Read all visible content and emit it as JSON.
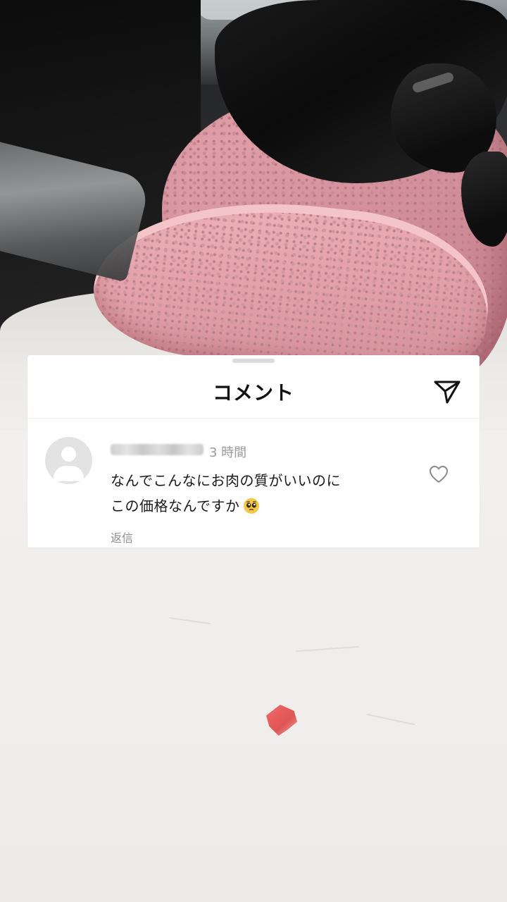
{
  "comments_sheet": {
    "title": "コメント",
    "send_icon": "send-paper-plane-icon",
    "comment": {
      "avatar_icon": "default-avatar-icon",
      "username_redacted": true,
      "timestamp": "3 時間",
      "text_line1": "なんでこんなにお肉の質がいいのに",
      "text_line2": "この価格なんですか",
      "emoji": "pleading-face-emoji",
      "reply_label": "返信",
      "like_icon": "heart-outline-icon"
    }
  },
  "colors": {
    "sheet_background": "#ffffff",
    "title_text": "#111111",
    "secondary_text": "#9a9a9a",
    "avatar_placeholder": "#e3e3e3"
  }
}
